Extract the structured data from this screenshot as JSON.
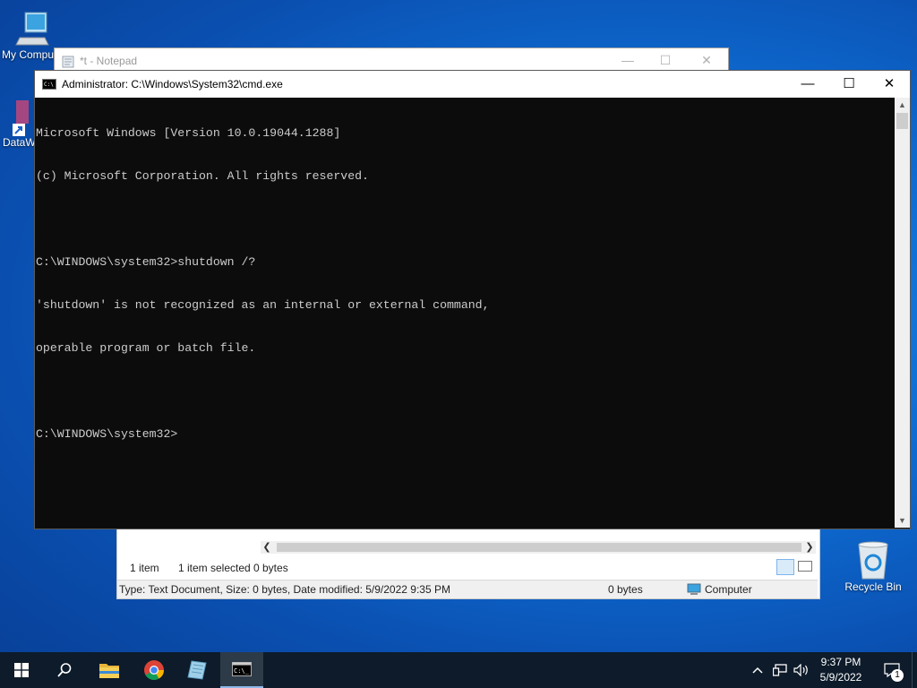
{
  "desktop": {
    "icons": [
      {
        "label": "My Compu"
      },
      {
        "label": "DataWC"
      },
      {
        "label": "Recycle Bin"
      }
    ]
  },
  "notepad": {
    "title": "*t - Notepad"
  },
  "explorer": {
    "item_count": "1 item",
    "selected": "1 item selected",
    "selected_size": "0 bytes",
    "details": "Type: Text Document, Size: 0 bytes, Date modified: 5/9/2022 9:35 PM",
    "size": "0 bytes",
    "location": "Computer"
  },
  "cmd": {
    "title": "Administrator: C:\\Windows\\System32\\cmd.exe",
    "lines": [
      "Microsoft Windows [Version 10.0.19044.1288]",
      "(c) Microsoft Corporation. All rights reserved.",
      "",
      "C:\\WINDOWS\\system32>shutdown /?",
      "'shutdown' is not recognized as an internal or external command,",
      "operable program or batch file.",
      "",
      "C:\\WINDOWS\\system32>"
    ]
  },
  "taskbar": {
    "time": "9:37 PM",
    "date": "5/9/2022",
    "notification_count": "1"
  }
}
